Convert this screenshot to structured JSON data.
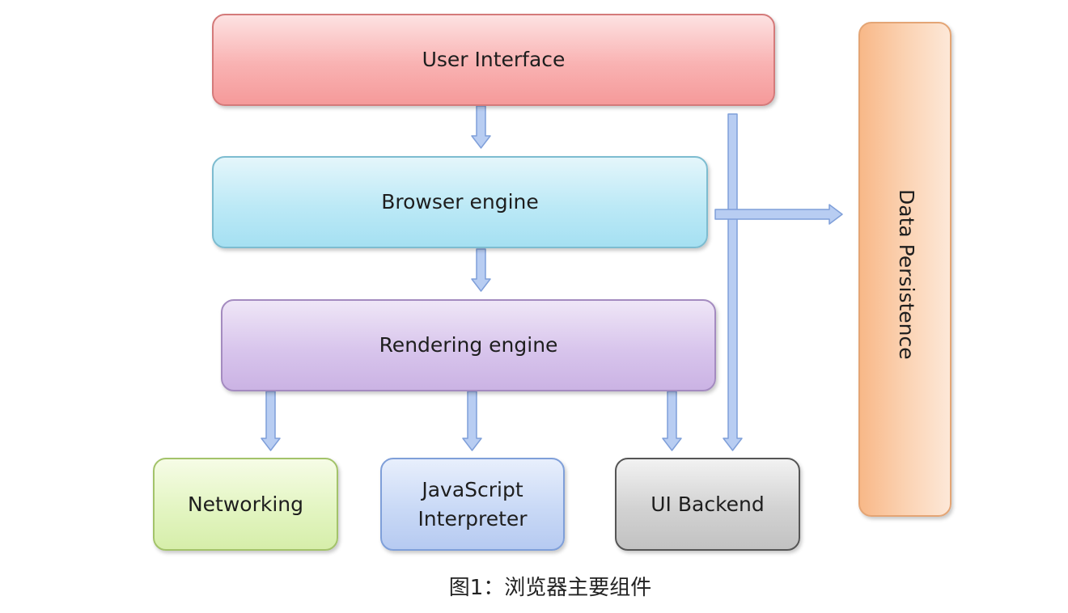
{
  "diagram": {
    "nodes": {
      "user_interface": {
        "label": "User  Interface",
        "color": "#f9b2b2"
      },
      "browser_engine": {
        "label": "Browser engine",
        "color": "#bce9f6"
      },
      "rendering_engine": {
        "label": "Rendering engine",
        "color": "#d8c5ec"
      },
      "networking": {
        "label": "Networking",
        "color": "#e3f5c2"
      },
      "javascript_interpreter": {
        "label": "JavaScript\nInterpreter",
        "color": "#c9d9f6"
      },
      "ui_backend": {
        "label": "UI Backend",
        "color": "#d2d2d2"
      },
      "data_persistence": {
        "label": "Data Persistence",
        "color": "#fbd2b2"
      }
    },
    "edges": [
      {
        "from": "user_interface",
        "to": "browser_engine"
      },
      {
        "from": "browser_engine",
        "to": "rendering_engine"
      },
      {
        "from": "rendering_engine",
        "to": "networking"
      },
      {
        "from": "rendering_engine",
        "to": "javascript_interpreter"
      },
      {
        "from": "rendering_engine",
        "to": "ui_backend"
      },
      {
        "from": "user_interface",
        "to": "ui_backend"
      },
      {
        "from": "browser_engine",
        "to": "data_persistence"
      }
    ],
    "arrow_color": "#b8cdf2",
    "arrow_outline": "#7f9fd9"
  },
  "caption": "图1：浏览器主要组件"
}
